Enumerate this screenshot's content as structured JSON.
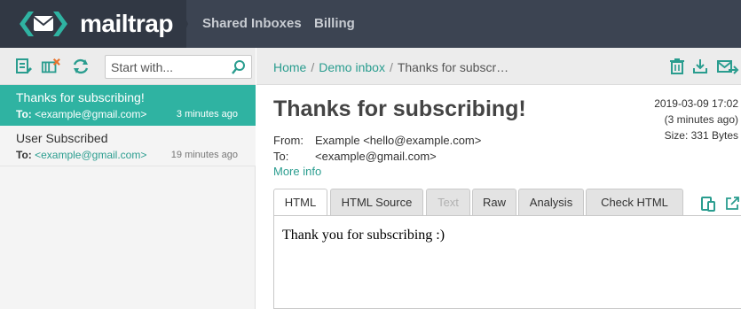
{
  "header": {
    "logo_icon": "mailtrap-envelope-logo",
    "brand_name": "mailtrap",
    "nav": [
      "Shared Inboxes",
      "Billing"
    ],
    "colors": {
      "background": "#3c4452",
      "brand_bg": "#313844",
      "accent": "#2fb3a2"
    }
  },
  "left_toolbar": {
    "icons": [
      "mark-as-read-icon",
      "clear-inbox-icon",
      "refresh-icon"
    ],
    "search": {
      "placeholder": "Start with...",
      "value": "",
      "icon": "search-icon"
    }
  },
  "messages": [
    {
      "subject": "Thanks for subscribing!",
      "to_label": "To:",
      "to": "<example@gmail.com>",
      "time": "3 minutes ago",
      "selected": true
    },
    {
      "subject": "User Subscribed",
      "to_label": "To:",
      "to": "<example@gmail.com>",
      "time": "19 minutes ago",
      "selected": false
    }
  ],
  "breadcrumb": {
    "home": "Home",
    "inbox": "Demo inbox",
    "current": "Thanks for subscr…"
  },
  "right_toolbar_icons": [
    "delete-icon",
    "download-icon",
    "forward-icon"
  ],
  "message": {
    "title": "Thanks for subscribing!",
    "date": "2019-03-09 17:02",
    "relative_time": "(3 minutes ago)",
    "size": "Size: 331 Bytes",
    "from_label": "From:",
    "from": "Example <hello@example.com>",
    "to_label": "To:",
    "to": "<example@gmail.com>",
    "more_info": "More info",
    "body": "Thank you for subscribing :)"
  },
  "tabs": [
    {
      "label": "HTML",
      "state": "active"
    },
    {
      "label": "HTML Source",
      "state": "normal"
    },
    {
      "label": "Text",
      "state": "disabled"
    },
    {
      "label": "Raw",
      "state": "normal"
    },
    {
      "label": "Analysis",
      "state": "normal"
    },
    {
      "label": "Check HTML",
      "state": "normal"
    }
  ],
  "tab_actions": [
    "device-preview-icon",
    "open-external-icon"
  ]
}
